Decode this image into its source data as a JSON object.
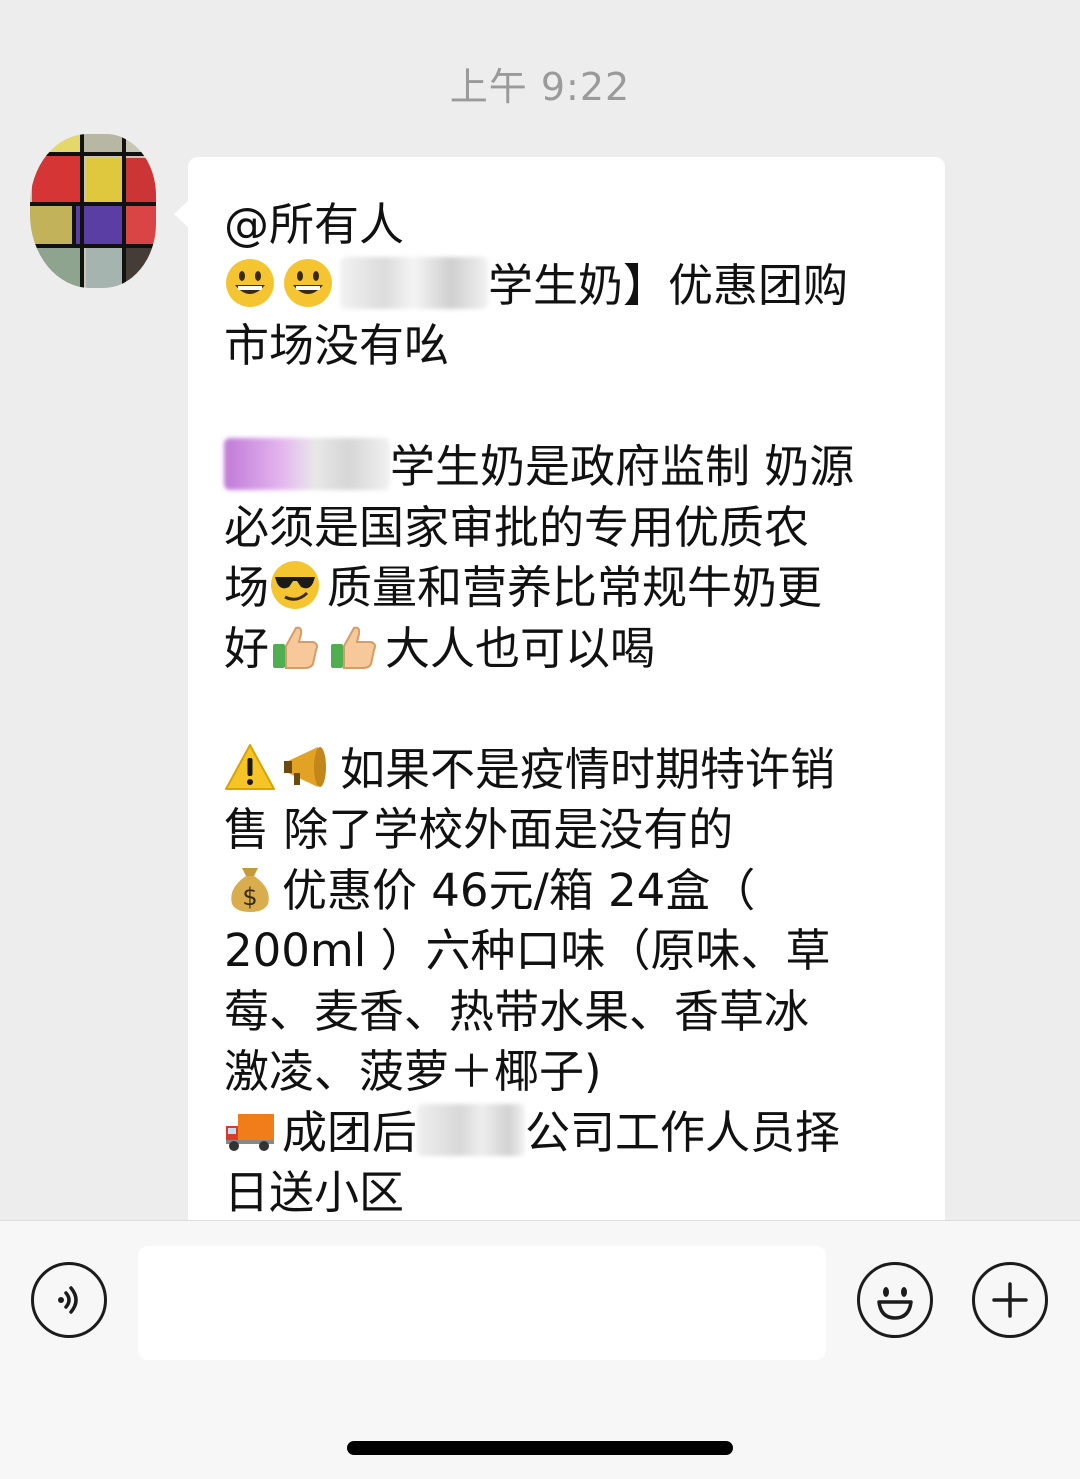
{
  "chat": {
    "timestamp": "上午 9:22"
  },
  "message": {
    "line1": "@所有人",
    "line2_text": "学生奶】优惠团购",
    "line3": " 市场没有吆",
    "line4_text": "学生奶是政府监制 奶源",
    "line5": "必须是国家审批的专用优质农",
    "line6_a": "场",
    "line6_b": "质量和营养比常规牛奶更",
    "line7_a": "好",
    "line7_b": "大人也可以喝",
    "line8_text": "如果不是疫情时期特许销",
    "line9": "售   除了学校外面是没有的",
    "line10_text": "优惠价 46元/箱   24盒（",
    "line11": "200ml ）六种口味（原味、草",
    "line12": "莓、麦香、热带水果、香草冰",
    "line13": "激凌、菠萝＋椰子)",
    "line14_a": "成团后",
    "line14_b": "公司工作人员择",
    "line15": "日送小区"
  },
  "icons": {
    "grin": "grinning-face-icon",
    "sunglasses": "sunglasses-face-icon",
    "thumbs_up": "thumbs-up-icon",
    "warning": "warning-sign-icon",
    "megaphone": "megaphone-icon",
    "money_bag": "money-bag-icon",
    "truck": "delivery-truck-icon",
    "voice": "voice-icon",
    "emoji": "emoji-icon",
    "plus": "plus-icon"
  },
  "colors": {
    "background": "#ededed",
    "bubble": "#ffffff",
    "timestamp": "#9a9a9a",
    "text": "#111111"
  }
}
